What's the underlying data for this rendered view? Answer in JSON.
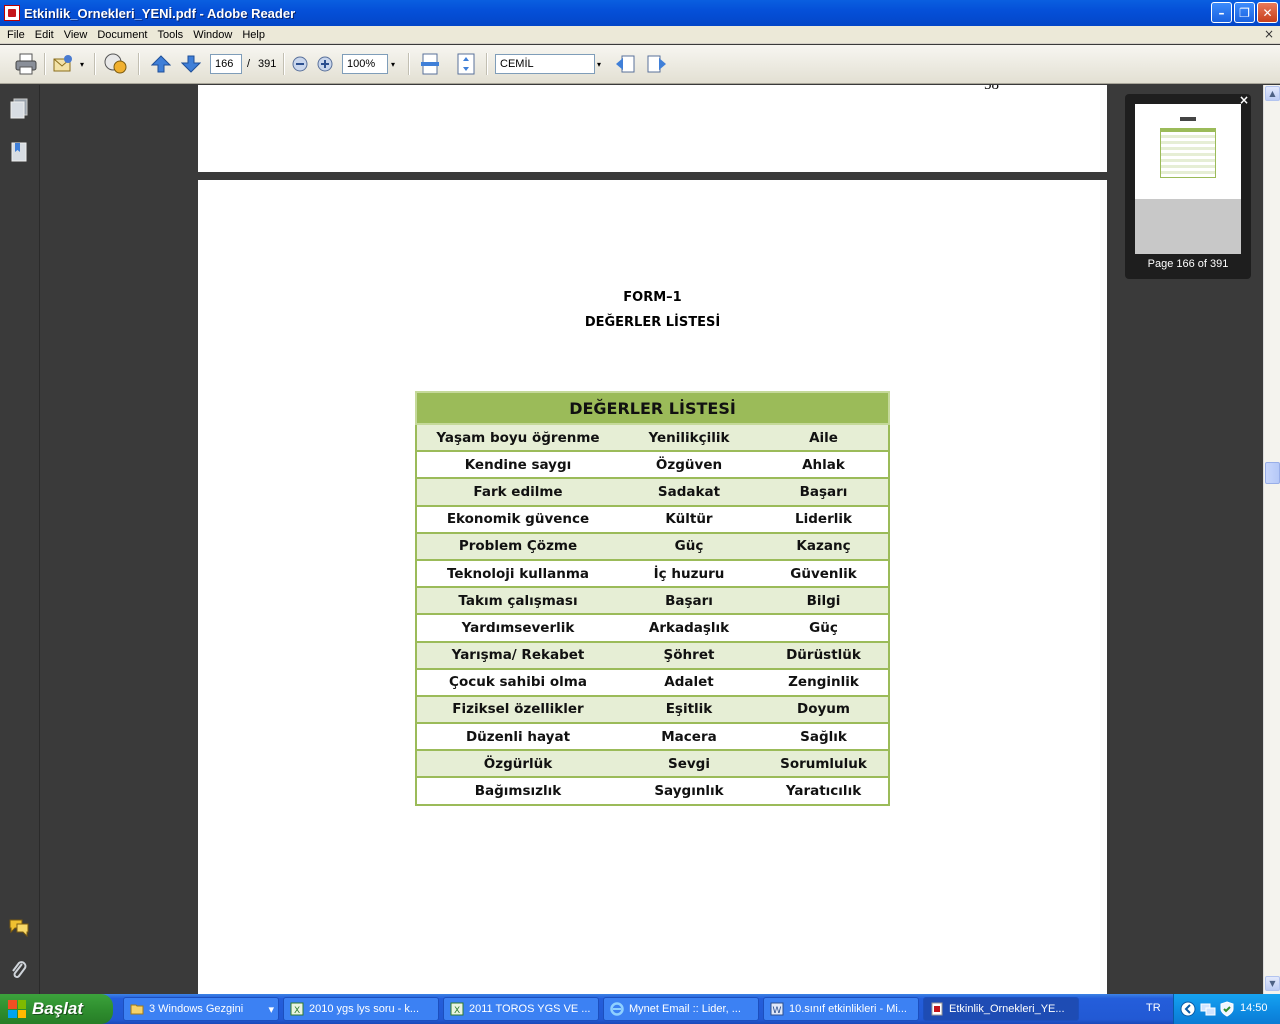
{
  "window": {
    "title": "Etkinlik_Ornekleri_YENİ.pdf - Adobe Reader",
    "minimize": "–",
    "maximize": "❐",
    "close": "✕"
  },
  "menu": [
    "File",
    "Edit",
    "View",
    "Document",
    "Tools",
    "Window",
    "Help"
  ],
  "menu_close": "×",
  "toolbar": {
    "page_current": "166",
    "page_sep": "/",
    "page_total": "391",
    "zoom": "100%",
    "find_value": "CEMİL",
    "dropdown_glyph": "▾"
  },
  "document": {
    "prev_page_number": "58",
    "form_title": "FORM–1",
    "form_subtitle": "DEĞERLER LİSTESİ",
    "table": {
      "header": "DEĞERLER LİSTESİ",
      "rows": [
        [
          "Yaşam boyu öğrenme",
          "Yenilikçilik",
          "Aile"
        ],
        [
          "Kendine saygı",
          "Özgüven",
          "Ahlak"
        ],
        [
          "Fark edilme",
          "Sadakat",
          "Başarı"
        ],
        [
          "Ekonomik güvence",
          "Kültür",
          "Liderlik"
        ],
        [
          "Problem Çözme",
          "Güç",
          "Kazanç"
        ],
        [
          "Teknoloji kullanma",
          "İç huzuru",
          "Güvenlik"
        ],
        [
          "Takım çalışması",
          "Başarı",
          "Bilgi"
        ],
        [
          "Yardımseverlik",
          "Arkadaşlık",
          "Güç"
        ],
        [
          "Yarışma/ Rekabet",
          "Şöhret",
          "Dürüstlük"
        ],
        [
          "Çocuk sahibi olma",
          "Adalet",
          "Zenginlik"
        ],
        [
          "Fiziksel özellikler",
          "Eşitlik",
          "Doyum"
        ],
        [
          "Düzenli hayat",
          "Macera",
          "Sağlık"
        ],
        [
          "Özgürlük",
          "Sevgi",
          "Sorumluluk"
        ],
        [
          "Bağımsızlık",
          "Saygınlık",
          "Yaratıcılık"
        ]
      ]
    }
  },
  "thumbnail": {
    "label": "Page 166 of 391",
    "close": "×"
  },
  "scrollbar": {
    "up": "▲",
    "down": "▼"
  },
  "taskbar": {
    "start": "Başlat",
    "tasks": [
      "3 Windows Gezgini",
      "2010 ygs lys soru - k...",
      "2011 TOROS YGS VE ...",
      "Mynet Email :: Lider, ...",
      "10.sınıf etkinlikleri - Mi...",
      "Etkinlik_Ornekleri_YE..."
    ],
    "task_dropdown": "▾",
    "language": "TR",
    "clock": "14:50"
  },
  "colors": {
    "titlebar": "#0550d8",
    "table_header": "#9bbb59",
    "table_row_alt": "#e6eed5",
    "taskbar": "#245edb",
    "start_button": "#2f8f2f"
  }
}
